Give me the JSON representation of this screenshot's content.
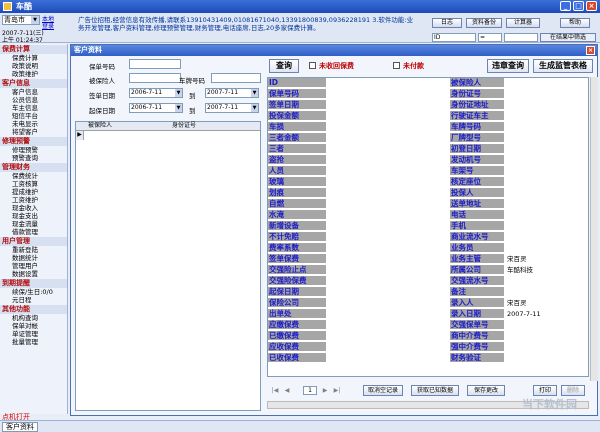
{
  "titlebar": {
    "title": "车酷"
  },
  "top": {
    "city": "青岛市",
    "link_local": "本地",
    "link_remote": "登录",
    "date": "2007-7-11(三)",
    "time": "上午 01:24:37",
    "ad_text": "广告位招租,经营信息有效传播,请联系13910431409,01081671040,13391800839,0936228191 3.软件功能:业务开发管理,客户资料管理,修理预警管理,财务管理,电话座席,日志,20多家保费计算。",
    "buttons": [
      "日志",
      "资料备份",
      "计算器",
      "帮助"
    ],
    "combo_field": "ID",
    "combo_op": "=",
    "filter_btn": "在结果中筛选"
  },
  "sidebar": {
    "sections": [
      {
        "title": "保费计算",
        "items": [
          "保费计算",
          "政策说明",
          "政策维护"
        ]
      },
      {
        "title": "客户信息",
        "items": [
          "客户信息",
          "公员信息",
          "车主信息",
          "短信平台",
          "未电显示",
          "将望客户"
        ]
      },
      {
        "title": "修理预警",
        "items": [
          "修理预警",
          "预警查询"
        ]
      },
      {
        "title": "管理财务",
        "items": [
          "保费统计",
          "工资核算",
          "提成维护",
          "工资维护",
          "现金收入",
          "现金支出",
          "现金流量",
          "借款管理"
        ]
      },
      {
        "title": "用户管理",
        "items": [
          "重新登陆",
          "数据统计",
          "管理用户",
          "数据设置"
        ]
      },
      {
        "title": "到期提醒",
        "items": [
          "续保/生日:0/0",
          "元日程"
        ]
      },
      {
        "title": "其他功能",
        "items": [
          "机构查询",
          "保单对帐",
          "单证管理",
          "批量管理"
        ]
      }
    ],
    "lock_warning": "点机打开"
  },
  "status": {
    "tab": "客户资料"
  },
  "child": {
    "title": "客户资料",
    "form": {
      "policy_no_label": "保单号码",
      "insured_label": "被保险人",
      "plate_label": "车牌号码",
      "sign_date_label": "签单日期",
      "start_date_label": "起保日期",
      "to_label": "到",
      "sign_from": "2006-7-11",
      "sign_to": "2007-7-11",
      "start_from": "2006-7-11",
      "start_to": "2007-7-11"
    },
    "query_btn": "查询",
    "unpaid_premium": "未收回保费",
    "unpaid": "未付款",
    "violation_btn": "违章查询",
    "report_btn": "生成监管表格",
    "grid_headers": [
      "被保险人",
      "身份证号"
    ],
    "left_labels": [
      "ID",
      "保单号码",
      "签单日期",
      "投保金额",
      "车损",
      "三者金额",
      "三者",
      "盗抢",
      "人员",
      "玻璃",
      "划痕",
      "自燃",
      "水淹",
      "新增设备",
      "不计免赔",
      "费率系数",
      "签单保费",
      "交强险止点",
      "交强险保费",
      "起保日期",
      "保险公司",
      "出单处",
      "应缴保费",
      "已缴保费",
      "应收保费",
      "已收保费"
    ],
    "right_labels": [
      "被保险人",
      "身份证号",
      "身份证地址",
      "行驶证车主",
      "车牌号码",
      "厂牌型号",
      "初登日期",
      "发动机号",
      "车架号",
      "核定座位",
      "投保人",
      "送单地址",
      "电话",
      "手机",
      "商业流水号",
      "业务员",
      "业务主管",
      "所属公司",
      "交强流水号",
      "备注",
      "录入人",
      "录入日期",
      "交强保单号",
      "商中介费号",
      "强中介费号",
      "财务验证"
    ],
    "right_values": {
      "业务主管": "宋百灵",
      "所属公司": "车酷科技",
      "录入人": "宋百灵",
      "录入日期": "2007-7-11"
    },
    "record_no": "1",
    "bottom_buttons": [
      "取消空记录",
      "获取已知数据",
      "保存更改",
      "打印",
      "删除"
    ]
  },
  "watermark": "当下软件园"
}
